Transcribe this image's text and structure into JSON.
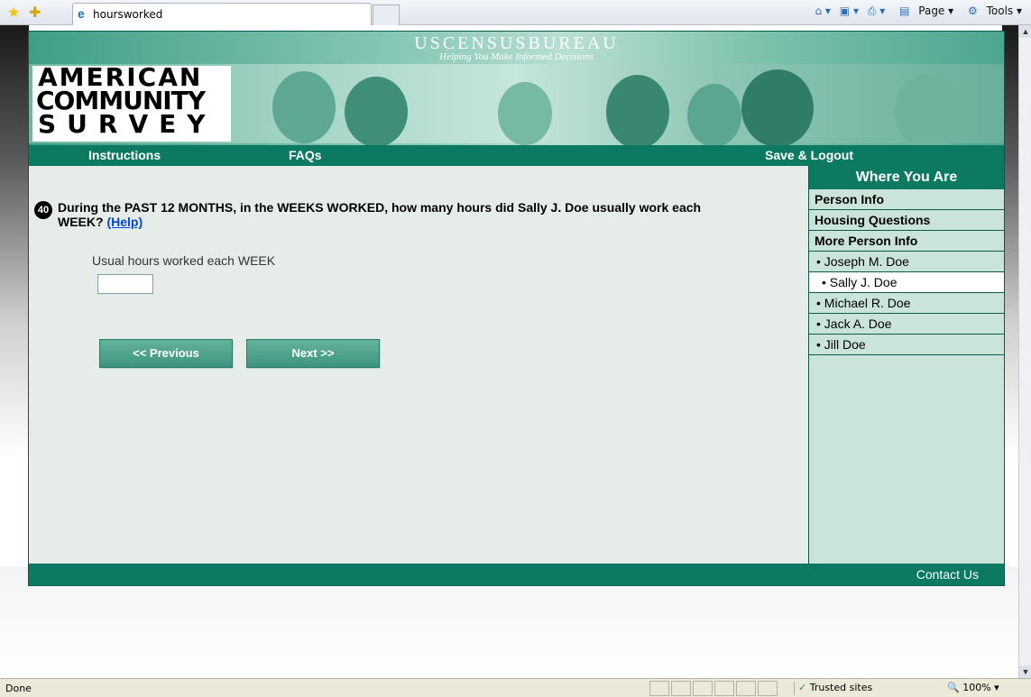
{
  "browser": {
    "tab_title": "hoursworked",
    "cmd_page": "Page",
    "cmd_tools": "Tools",
    "status_text": "Done",
    "zone": "Trusted sites",
    "zoom": "100%"
  },
  "header": {
    "agency": "USCENSUSBUREAU",
    "tagline": "Helping You Make Informed Decisions",
    "logo_lines": [
      "AMERICAN",
      "COMMUNITY",
      "SURVEY"
    ]
  },
  "nav": {
    "instructions": "Instructions",
    "faqs": "FAQs",
    "save_logout": "Save & Logout"
  },
  "question": {
    "number": "40",
    "text": "During the PAST 12 MONTHS, in the WEEKS WORKED, how many hours did Sally J. Doe usually work each WEEK?",
    "help": "(Help)",
    "field_label": "Usual hours worked each WEEK",
    "field_value": ""
  },
  "buttons": {
    "previous": "<<  Previous",
    "next": "Next  >>"
  },
  "sidebar": {
    "title": "Where You Are",
    "sections": [
      "Person Info",
      "Housing Questions",
      "More Person Info"
    ],
    "persons": [
      "• Joseph M. Doe",
      "• Sally J. Doe",
      "• Michael R. Doe",
      "• Jack A. Doe",
      "• Jill Doe"
    ],
    "current_person": "• Sally J. Doe"
  },
  "footer": {
    "contact": "Contact Us"
  },
  "colors": {
    "primary_green": "#0c7a63",
    "sidebar_bg": "#cbe4da",
    "content_bg": "#e6ede9",
    "link_blue": "#0645d8"
  }
}
